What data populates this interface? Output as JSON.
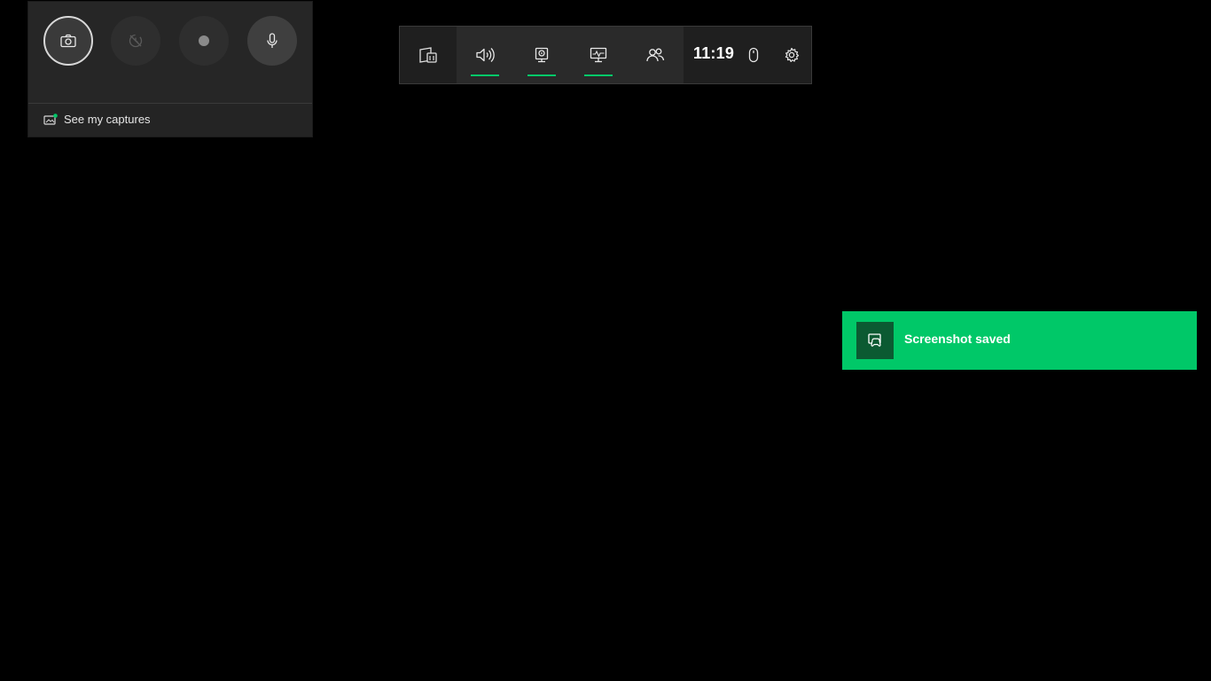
{
  "capture_widget": {
    "buttons": [
      {
        "icon": "camera-icon",
        "state": "active"
      },
      {
        "icon": "record-last-30s-icon",
        "state": "disabled"
      },
      {
        "icon": "record-dot-icon",
        "state": "disabled"
      },
      {
        "icon": "microphone-icon",
        "state": "normal"
      }
    ],
    "footer": {
      "icon": "gallery-icon",
      "label": "See my captures"
    }
  },
  "game_bar": {
    "widgets": [
      {
        "icon": "widget-menu-icon",
        "active": false
      },
      {
        "icon": "audio-icon",
        "active": true
      },
      {
        "icon": "capture-icon",
        "active": true
      },
      {
        "icon": "performance-icon",
        "active": true
      },
      {
        "icon": "social-icon",
        "active": false
      }
    ],
    "clock": "11:19",
    "right_icons": [
      "mouse-icon",
      "settings-icon"
    ],
    "accent_color": "#00c868"
  },
  "toast": {
    "icon": "screenshot-saved-icon",
    "message": "Screenshot saved",
    "background": "#00c868"
  }
}
